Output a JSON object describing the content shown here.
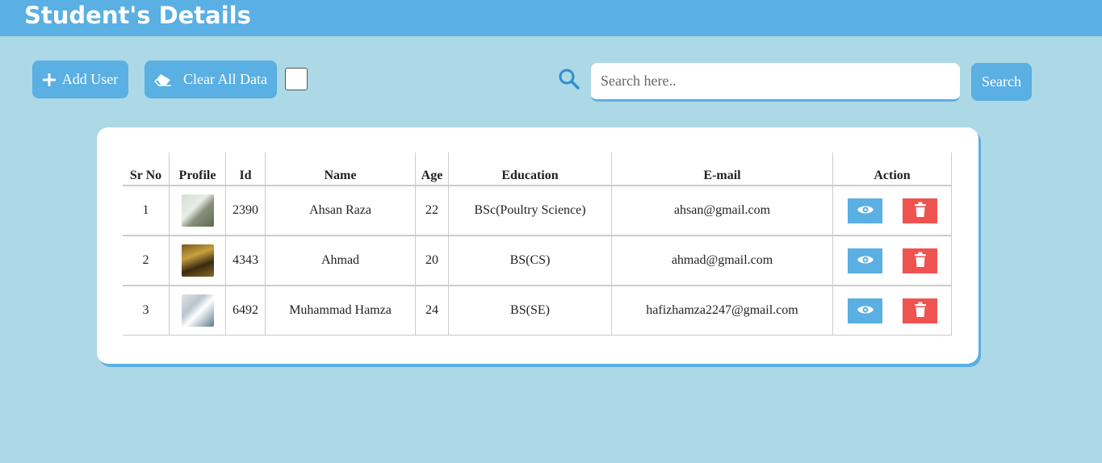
{
  "header": {
    "title": "Student's Details"
  },
  "toolbar": {
    "add_label": "Add User",
    "clear_label": "Clear All Data",
    "search_placeholder": "Search here..",
    "search_value": "",
    "search_button": "Search",
    "checkbox_checked": false
  },
  "table": {
    "columns": [
      "Sr No",
      "Profile",
      "Id",
      "Name",
      "Age",
      "Education",
      "E-mail",
      "Action"
    ],
    "rows": [
      {
        "sr": "1",
        "id": "2390",
        "name": "Ahsan Raza",
        "age": "22",
        "education": "BSc(Poultry Science)",
        "email": "ahsan@gmail.com"
      },
      {
        "sr": "2",
        "id": "4343",
        "name": "Ahmad",
        "age": "20",
        "education": "BS(CS)",
        "email": "ahmad@gmail.com"
      },
      {
        "sr": "3",
        "id": "6492",
        "name": "Muhammad Hamza",
        "age": "24",
        "education": "BS(SE)",
        "email": "hafizhamza2247@gmail.com"
      }
    ]
  },
  "icons": {
    "add": "plus-icon",
    "clear": "eraser-icon",
    "search": "search-icon",
    "view": "eye-icon",
    "delete": "trash-icon"
  },
  "colors": {
    "background": "#add8e6",
    "primary": "#5aafe3",
    "danger": "#ef5350",
    "card": "#ffffff"
  }
}
